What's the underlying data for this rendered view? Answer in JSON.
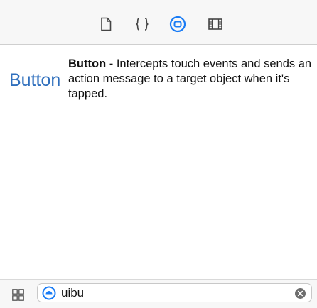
{
  "toolbar": {
    "tabs": [
      {
        "icon": "file-icon"
      },
      {
        "icon": "code-braces-icon"
      },
      {
        "icon": "object-library-icon",
        "selected": true
      },
      {
        "icon": "media-library-icon"
      }
    ],
    "accent_color": "#1a7cf5"
  },
  "library_item": {
    "display_label": "Button",
    "name": "Button",
    "description": " - Intercepts touch events and sends an action message to a target object when it's tapped.",
    "label_color": "#2f6fbd"
  },
  "filter": {
    "grid_toggle_icon": "grid-view-icon",
    "filter_icon": "object-filter-icon",
    "value": "uibu",
    "clear_icon": "clear-icon"
  }
}
